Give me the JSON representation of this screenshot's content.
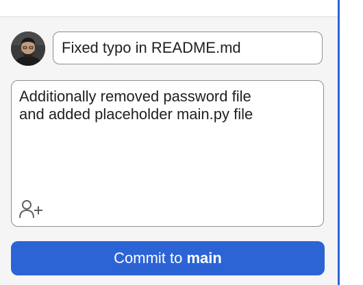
{
  "commit": {
    "summary": "Fixed typo in README.md",
    "description": "Additionally removed password file\nand added placeholder main.py file",
    "button_prefix": "Commit to",
    "branch": "main"
  },
  "icons": {
    "avatar": "user-avatar",
    "coauthor": "add-coauthor-icon"
  },
  "colors": {
    "accent": "#2c64d6",
    "panel_bg": "#f5f5f6",
    "field_border": "#8e8e93"
  }
}
